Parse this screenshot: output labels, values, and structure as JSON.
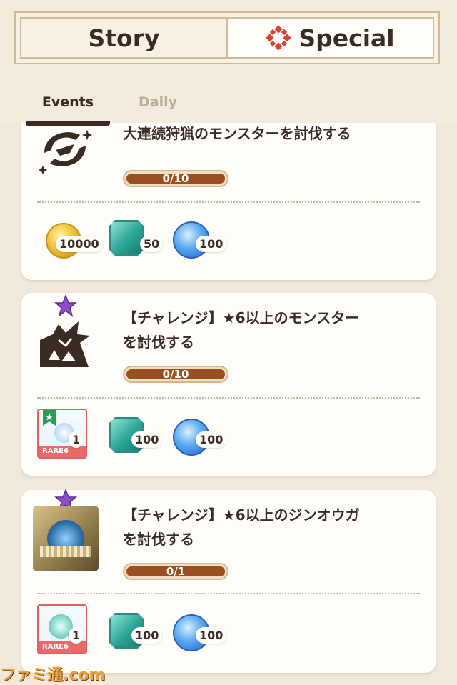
{
  "header": {
    "story_label": "Story",
    "special_label": "Special",
    "special_icon": "special-emblem-icon"
  },
  "tabs": {
    "events_label": "Events",
    "daily_label": "Daily"
  },
  "quests": [
    {
      "title": "大連続狩猟のモンスターを討伐する",
      "progress_text": "0/10",
      "progress": 0,
      "rewards": [
        {
          "type": "coin-icon",
          "amount": "10000"
        },
        {
          "type": "gem-icon",
          "amount": "50"
        },
        {
          "type": "orb-icon",
          "amount": "100"
        }
      ]
    },
    {
      "title_line1": "【チャレンジ】★6以上のモンスター",
      "title_line2": "を討伐する",
      "progress_text": "0/10",
      "progress": 0,
      "rewards": [
        {
          "type": "rare-item-icon",
          "amount": "1",
          "rarity": "RARE6"
        },
        {
          "type": "gem-icon",
          "amount": "100"
        },
        {
          "type": "orb-icon",
          "amount": "100"
        }
      ]
    },
    {
      "title_line1": "【チャレンジ】★6以上のジンオウガ",
      "title_line2": "を討伐する",
      "progress_text": "0/1",
      "progress": 0,
      "rewards": [
        {
          "type": "rare-item-icon",
          "amount": "1",
          "rarity": "RARE6"
        },
        {
          "type": "gem-icon",
          "amount": "100"
        },
        {
          "type": "orb-icon",
          "amount": "100"
        }
      ]
    }
  ],
  "watermark": "ファミ通.com",
  "colors": {
    "background": "#f1eadc",
    "card": "#fffdf9",
    "progress_fill": "#9b4e1f",
    "accent_red": "#d4463a",
    "purple_star": "#8a4ec9"
  }
}
